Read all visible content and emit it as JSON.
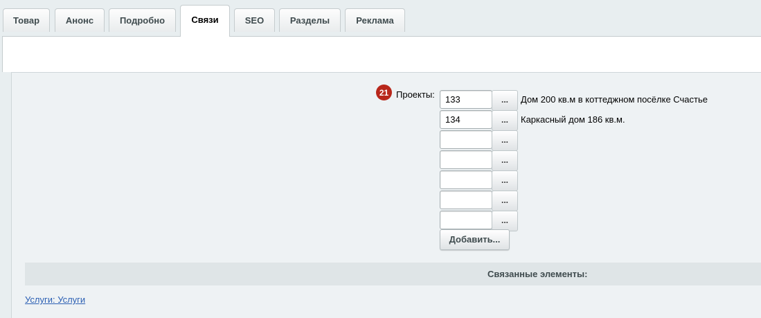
{
  "tabs": [
    {
      "label": "Товар"
    },
    {
      "label": "Анонс"
    },
    {
      "label": "Подробно"
    },
    {
      "label": "Связи"
    },
    {
      "label": "SEO"
    },
    {
      "label": "Разделы"
    },
    {
      "label": "Реклама"
    }
  ],
  "active_tab": "Связи",
  "projects": {
    "badge": "21",
    "label": "Проекты:",
    "rows": [
      {
        "value": "133",
        "description": "Дом 200 кв.м в коттеджном посёлке Счастье"
      },
      {
        "value": "134",
        "description": "Каркасный дом 186 кв.м."
      },
      {
        "value": "",
        "description": ""
      },
      {
        "value": "",
        "description": ""
      },
      {
        "value": "",
        "description": ""
      },
      {
        "value": "",
        "description": ""
      },
      {
        "value": "",
        "description": ""
      }
    ],
    "browse_label": "...",
    "add_label": "Добавить..."
  },
  "linked": {
    "title": "Связанные элементы:",
    "link": "Услуги: Услуги"
  },
  "colors": {
    "badge": "#b8271b",
    "link": "#2b5fb3",
    "section_bar": "#dfe5e7"
  }
}
